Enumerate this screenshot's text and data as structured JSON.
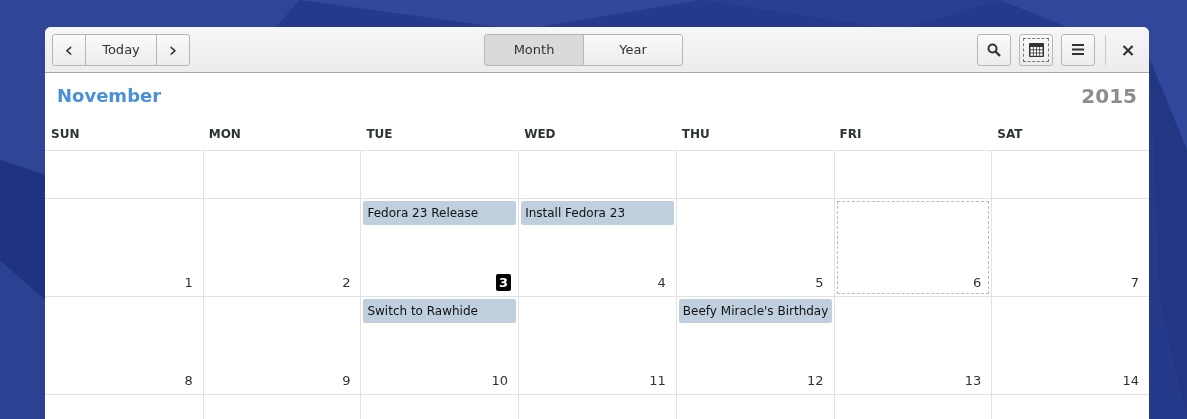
{
  "header": {
    "nav": {
      "prev": "‹",
      "today": "Today",
      "next": "›"
    },
    "views": [
      {
        "label": "Month",
        "selected": true
      },
      {
        "label": "Year",
        "selected": false
      }
    ],
    "tools": [
      {
        "kind": "search",
        "focused": false
      },
      {
        "kind": "calendar",
        "focused": true
      },
      {
        "kind": "menu",
        "focused": false
      }
    ],
    "close": "×"
  },
  "month": "November",
  "year": "2015",
  "weekdays": [
    "SUN",
    "MON",
    "TUE",
    "WED",
    "THU",
    "FRI",
    "SAT"
  ],
  "weeks": [
    {
      "kind": "blank_short"
    },
    {
      "kind": "full",
      "days": [
        {
          "number": "1",
          "today": false,
          "selected": false
        },
        {
          "number": "2",
          "today": false,
          "selected": false
        },
        {
          "number": "3",
          "today": true,
          "selected": false,
          "events": [
            "Fedora 23 Release"
          ]
        },
        {
          "number": "4",
          "today": false,
          "selected": false,
          "events": [
            "Install Fedora 23"
          ]
        },
        {
          "number": "5",
          "today": false,
          "selected": false
        },
        {
          "number": "6",
          "today": false,
          "selected": true
        },
        {
          "number": "7",
          "today": false,
          "selected": false
        }
      ]
    },
    {
      "kind": "full",
      "days": [
        {
          "number": "8",
          "today": false,
          "selected": false
        },
        {
          "number": "9",
          "today": false,
          "selected": false
        },
        {
          "number": "10",
          "today": false,
          "selected": false,
          "events": [
            "Switch to Rawhide"
          ]
        },
        {
          "number": "11",
          "today": false,
          "selected": false
        },
        {
          "number": "12",
          "today": false,
          "selected": false,
          "events": [
            "Beefy Miracle's Birthday"
          ]
        },
        {
          "number": "13",
          "today": false,
          "selected": false
        },
        {
          "number": "14",
          "today": false,
          "selected": false
        }
      ]
    },
    {
      "kind": "blank_full"
    }
  ]
}
